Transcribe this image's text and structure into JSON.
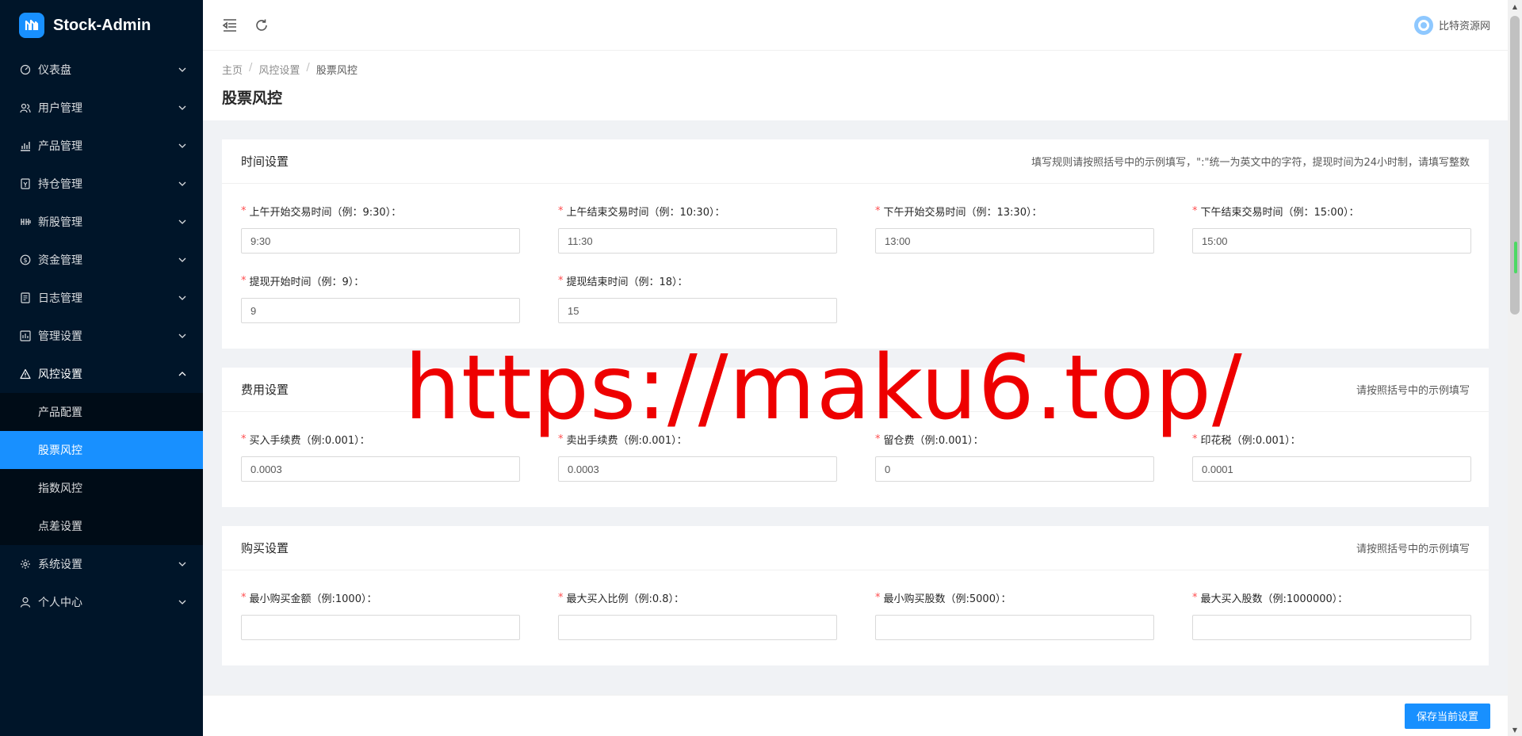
{
  "app": {
    "name": "Stock-Admin"
  },
  "sidebar": {
    "items": [
      {
        "label": "仪表盘",
        "icon": "dashboard-icon"
      },
      {
        "label": "用户管理",
        "icon": "users-icon"
      },
      {
        "label": "产品管理",
        "icon": "chart-icon"
      },
      {
        "label": "持仓管理",
        "icon": "position-icon"
      },
      {
        "label": "新股管理",
        "icon": "ipo-icon"
      },
      {
        "label": "资金管理",
        "icon": "money-icon"
      },
      {
        "label": "日志管理",
        "icon": "log-icon"
      },
      {
        "label": "管理设置",
        "icon": "admin-settings-icon"
      },
      {
        "label": "风控设置",
        "icon": "warning-icon"
      }
    ],
    "risk_submenu": [
      {
        "label": "产品配置"
      },
      {
        "label": "股票风控"
      },
      {
        "label": "指数风控"
      },
      {
        "label": "点差设置"
      }
    ],
    "bottom_items": [
      {
        "label": "系统设置",
        "icon": "gear-icon"
      },
      {
        "label": "个人中心",
        "icon": "user-icon"
      }
    ]
  },
  "header": {
    "user_name": "比特资源网"
  },
  "breadcrumb": {
    "home": "主页",
    "parent": "风控设置",
    "current": "股票风控",
    "sep": "/"
  },
  "page": {
    "title": "股票风控"
  },
  "sections": {
    "time": {
      "title": "时间设置",
      "hint": "填写规则请按照括号中的示例填写，\":\"统一为英文中的字符，提现时间为24小时制，请填写整数",
      "fields": [
        {
          "label": "上午开始交易时间（例：9:30）：",
          "value": "9:30"
        },
        {
          "label": "上午结束交易时间（例：10:30）：",
          "value": "11:30"
        },
        {
          "label": "下午开始交易时间（例：13:30）：",
          "value": "13:00"
        },
        {
          "label": "下午结束交易时间（例：15:00）：",
          "value": "15:00"
        },
        {
          "label": "提现开始时间（例：9）：",
          "value": "9"
        },
        {
          "label": "提现结束时间（例：18）：",
          "value": "15"
        }
      ]
    },
    "fee": {
      "title": "费用设置",
      "hint": "请按照括号中的示例填写",
      "fields": [
        {
          "label": "买入手续费（例:0.001）：",
          "value": "0.0003"
        },
        {
          "label": "卖出手续费（例:0.001）：",
          "value": "0.0003"
        },
        {
          "label": "留仓费（例:0.001）：",
          "value": "0"
        },
        {
          "label": "印花税（例:0.001）：",
          "value": "0.0001"
        }
      ]
    },
    "buy": {
      "title": "购买设置",
      "hint": "请按照括号中的示例填写",
      "fields": [
        {
          "label": "最小购买金额（例:1000）：",
          "value": ""
        },
        {
          "label": "最大买入比例（例:0.8）：",
          "value": ""
        },
        {
          "label": "最小购买股数（例:5000）：",
          "value": ""
        },
        {
          "label": "最大买入股数（例:1000000）：",
          "value": ""
        }
      ]
    }
  },
  "footer": {
    "save_label": "保存当前设置"
  },
  "watermark": {
    "text": "https://maku6.top/"
  },
  "colors": {
    "primary": "#1890ff",
    "sidebar": "#001529",
    "required": "#ff4d4f",
    "watermark": "#ee0000"
  }
}
